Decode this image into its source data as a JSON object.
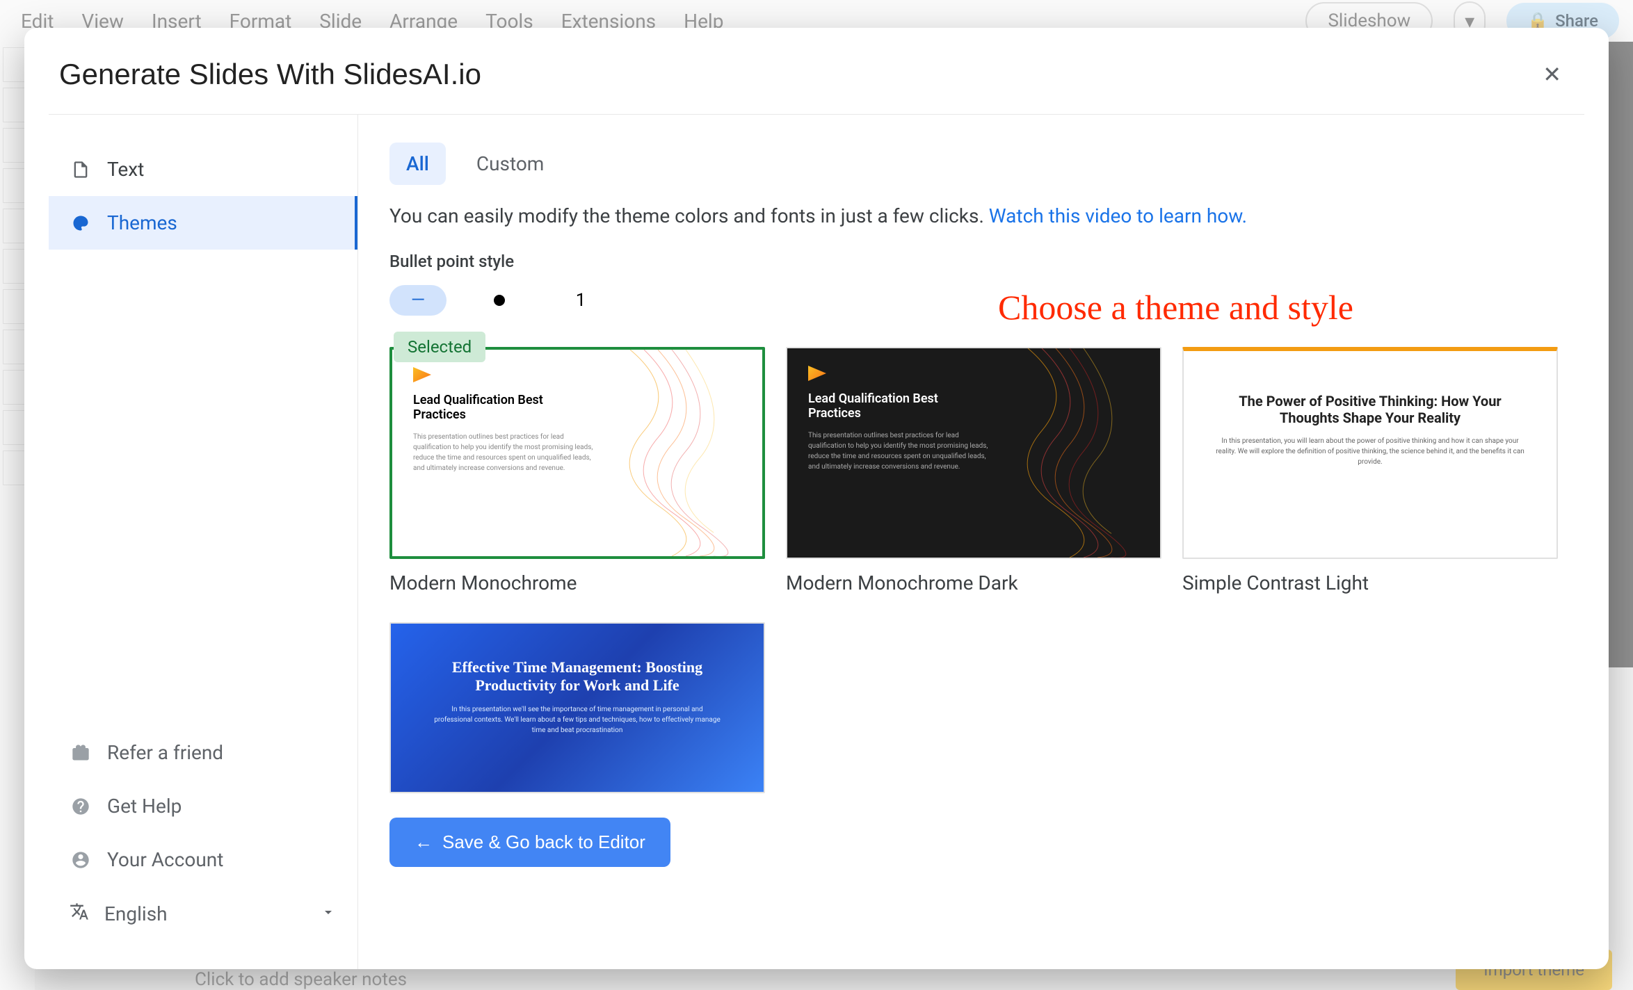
{
  "bg": {
    "menu": [
      "Edit",
      "View",
      "Insert",
      "Format",
      "Slide",
      "Arrange",
      "Tools",
      "Extensions",
      "Help"
    ],
    "slideshow": "Slideshow",
    "share": "Share",
    "speaker_notes": "Click to add speaker notes",
    "import_theme": "Import theme"
  },
  "modal": {
    "title": "Generate Slides With SlidesAI.io",
    "close_glyph": "✕"
  },
  "sidebar": {
    "text": "Text",
    "themes": "Themes",
    "refer": "Refer a friend",
    "help": "Get Help",
    "account": "Your Account",
    "language": "English"
  },
  "tabs": {
    "all": "All",
    "custom": "Custom"
  },
  "helper": {
    "text": "You can easily modify the theme colors and fonts in just a few clicks. ",
    "link": "Watch this video to learn how."
  },
  "bullet": {
    "label": "Bullet point style",
    "dash": "—",
    "number": "1"
  },
  "annotation": "Choose a theme and style",
  "themes": {
    "selected_label": "Selected",
    "items": [
      {
        "name": "Modern Monochrome",
        "title": "Lead Qualification Best Practices",
        "desc": "This presentation outlines best practices for lead qualification to help you identify the most promising leads, reduce the time and resources spent on unqualified leads, and ultimately increase conversions and revenue."
      },
      {
        "name": "Modern Monochrome Dark",
        "title": "Lead Qualification Best Practices",
        "desc": "This presentation outlines best practices for lead qualification to help you identify the most promising leads, reduce the time and resources spent on unqualified leads, and ultimately increase conversions and revenue."
      },
      {
        "name": "Simple Contrast Light",
        "title": "The Power of Positive Thinking: How Your Thoughts Shape Your Reality",
        "desc": "In this presentation, you will learn about the power of positive thinking and how it can shape your reality. We will explore the definition of positive thinking, the science behind it, and the benefits it can provide."
      },
      {
        "name": "",
        "title": "Effective Time Management: Boosting Productivity for Work and Life",
        "desc": "In this presentation we'll see the importance of time management in personal and professional contexts. We'll learn about a few tips and techniques, how to effectively manage time and beat procrastination"
      }
    ]
  },
  "save_button": "Save & Go back to Editor"
}
